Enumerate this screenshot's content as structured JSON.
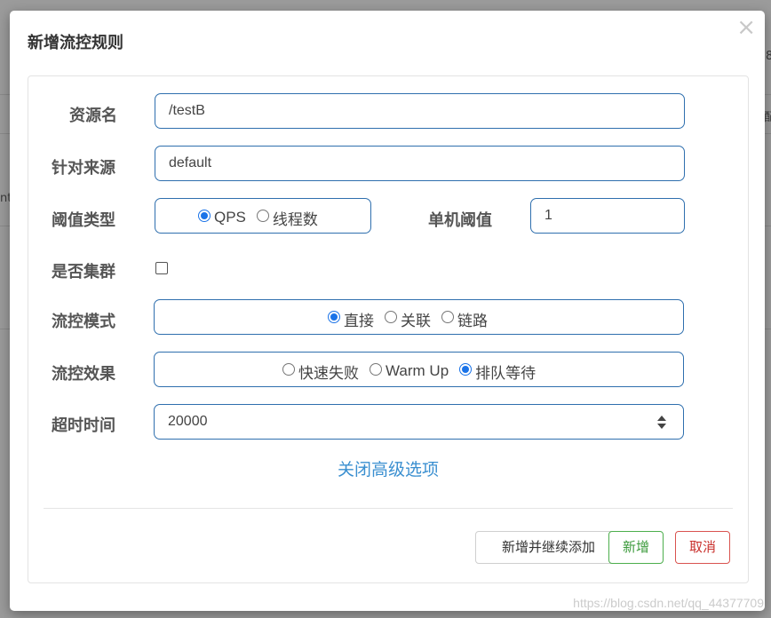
{
  "dialog": {
    "title": "新增流控规则",
    "close_symbol": "×"
  },
  "form": {
    "resource_name": {
      "label": "资源名",
      "value": "/testB"
    },
    "limit_app": {
      "label": "针对来源",
      "value": "default"
    },
    "grade": {
      "label": "阈值类型",
      "options": [
        {
          "label": "QPS",
          "checked": true
        },
        {
          "label": "线程数",
          "checked": false
        }
      ]
    },
    "count": {
      "label": "单机阈值",
      "value": "1"
    },
    "cluster": {
      "label": "是否集群",
      "checked": false
    },
    "strategy": {
      "label": "流控模式",
      "options": [
        {
          "label": "直接",
          "checked": true
        },
        {
          "label": "关联",
          "checked": false
        },
        {
          "label": "链路",
          "checked": false
        }
      ]
    },
    "control_behavior": {
      "label": "流控效果",
      "options": [
        {
          "label": "快速失败",
          "checked": false
        },
        {
          "label": "Warm Up",
          "checked": false
        },
        {
          "label": "排队等待",
          "checked": true
        }
      ]
    },
    "timeout": {
      "label": "超时时间",
      "value": "20000"
    },
    "advanced_link": "关闭高级选项"
  },
  "footer": {
    "add_continue_label": "新增并继续添加",
    "add_label": "新增",
    "cancel_label": "取消"
  },
  "background": {
    "frag_right_top": "8",
    "frag_right_mid": "配",
    "frag_left": "nt"
  },
  "watermark": "https://blog.csdn.net/qq_44377709",
  "colors": {
    "input_border": "#2f6fae",
    "link": "#3a8fd0",
    "success": "#4cae4c",
    "danger": "#d9534f",
    "radio_checked": "#1a73e8"
  }
}
